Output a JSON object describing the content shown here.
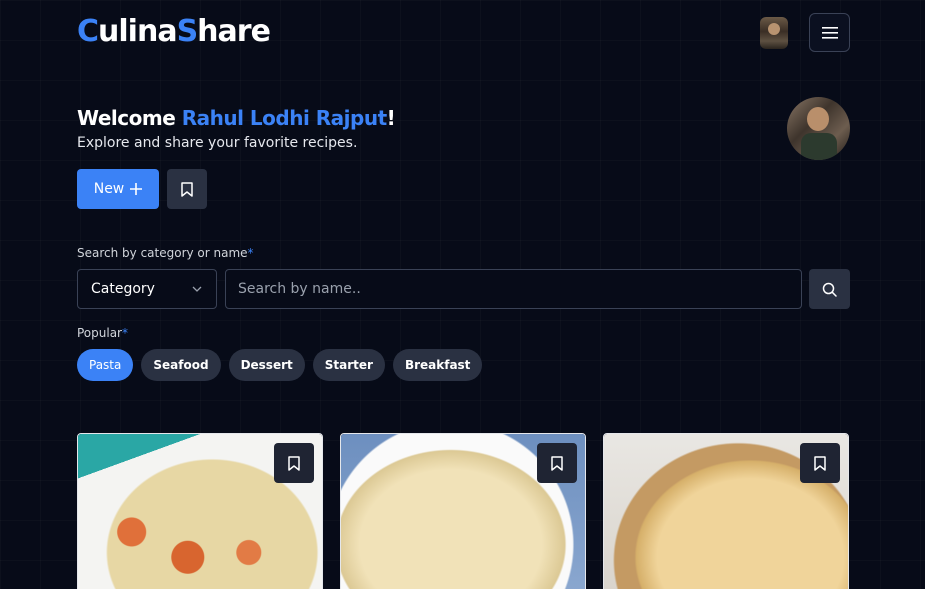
{
  "header": {
    "logo_c": "C",
    "logo_ulina": "ulina",
    "logo_s": "S",
    "logo_hare": "hare"
  },
  "welcome": {
    "prefix": "Welcome ",
    "name": "Rahul Lodhi Rajput",
    "suffix": "!",
    "subtitle": "Explore and share your favorite recipes."
  },
  "actions": {
    "new_label": "New"
  },
  "search": {
    "label": "Search by category or name",
    "required_mark": "*",
    "category_value": "Category",
    "placeholder": "Search by name.."
  },
  "popular": {
    "label": "Popular",
    "required_mark": "*",
    "chips": [
      "Pasta",
      "Seafood",
      "Dessert",
      "Starter",
      "Breakfast"
    ]
  },
  "colors": {
    "accent": "#3b82f6",
    "background": "#070b18",
    "muted_button": "#2a3142"
  },
  "icons": {
    "menu": "hamburger-menu-icon",
    "plus": "plus-icon",
    "bookmark": "bookmark-icon",
    "chevron": "chevron-down-icon",
    "search": "search-icon"
  }
}
